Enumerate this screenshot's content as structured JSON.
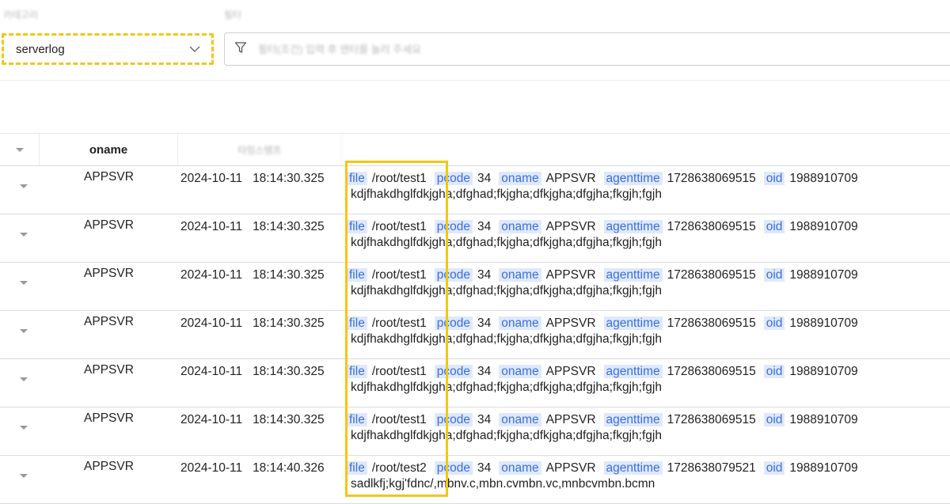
{
  "category": {
    "label": "카테고리",
    "value": "serverlog"
  },
  "filter": {
    "label": "필터",
    "placeholder": "필터(조건) 입력 후 엔터를 눌러 주세요"
  },
  "table": {
    "columns": [
      "oname",
      "타임스탬프"
    ],
    "rows": [
      {
        "oname": "APPSVR",
        "date": "2024-10-11",
        "time": "18:14:30.325",
        "fields": [
          {
            "k": "file",
            "v": "/root/test1"
          },
          {
            "k": "pcode",
            "v": "34"
          },
          {
            "k": "oname",
            "v": "APPSVR"
          },
          {
            "k": "agenttime",
            "v": "1728638069515"
          },
          {
            "k": "oid",
            "v": "1988910709"
          }
        ],
        "text": "kdjfhakdhglfdkjgha;dfghad;fkjgha;dfkjgha;dfgjha;fkgjh;fgjh"
      },
      {
        "oname": "APPSVR",
        "date": "2024-10-11",
        "time": "18:14:30.325",
        "fields": [
          {
            "k": "file",
            "v": "/root/test1"
          },
          {
            "k": "pcode",
            "v": "34"
          },
          {
            "k": "oname",
            "v": "APPSVR"
          },
          {
            "k": "agenttime",
            "v": "1728638069515"
          },
          {
            "k": "oid",
            "v": "1988910709"
          }
        ],
        "text": "kdjfhakdhglfdkjgha;dfghad;fkjgha;dfkjgha;dfgjha;fkgjh;fgjh"
      },
      {
        "oname": "APPSVR",
        "date": "2024-10-11",
        "time": "18:14:30.325",
        "fields": [
          {
            "k": "file",
            "v": "/root/test1"
          },
          {
            "k": "pcode",
            "v": "34"
          },
          {
            "k": "oname",
            "v": "APPSVR"
          },
          {
            "k": "agenttime",
            "v": "1728638069515"
          },
          {
            "k": "oid",
            "v": "1988910709"
          }
        ],
        "text": "kdjfhakdhglfdkjgha;dfghad;fkjgha;dfkjgha;dfgjha;fkgjh;fgjh"
      },
      {
        "oname": "APPSVR",
        "date": "2024-10-11",
        "time": "18:14:30.325",
        "fields": [
          {
            "k": "file",
            "v": "/root/test1"
          },
          {
            "k": "pcode",
            "v": "34"
          },
          {
            "k": "oname",
            "v": "APPSVR"
          },
          {
            "k": "agenttime",
            "v": "1728638069515"
          },
          {
            "k": "oid",
            "v": "1988910709"
          }
        ],
        "text": "kdjfhakdhglfdkjgha;dfghad;fkjgha;dfkjgha;dfgjha;fkgjh;fgjh"
      },
      {
        "oname": "APPSVR",
        "date": "2024-10-11",
        "time": "18:14:30.325",
        "fields": [
          {
            "k": "file",
            "v": "/root/test1"
          },
          {
            "k": "pcode",
            "v": "34"
          },
          {
            "k": "oname",
            "v": "APPSVR"
          },
          {
            "k": "agenttime",
            "v": "1728638069515"
          },
          {
            "k": "oid",
            "v": "1988910709"
          }
        ],
        "text": "kdjfhakdhglfdkjgha;dfghad;fkjgha;dfkjgha;dfgjha;fkgjh;fgjh"
      },
      {
        "oname": "APPSVR",
        "date": "2024-10-11",
        "time": "18:14:30.325",
        "fields": [
          {
            "k": "file",
            "v": "/root/test1"
          },
          {
            "k": "pcode",
            "v": "34"
          },
          {
            "k": "oname",
            "v": "APPSVR"
          },
          {
            "k": "agenttime",
            "v": "1728638069515"
          },
          {
            "k": "oid",
            "v": "1988910709"
          }
        ],
        "text": "kdjfhakdhglfdkjgha;dfghad;fkjgha;dfkjgha;dfgjha;fkgjh;fgjh"
      },
      {
        "oname": "APPSVR",
        "date": "2024-10-11",
        "time": "18:14:40.326",
        "fields": [
          {
            "k": "file",
            "v": "/root/test2"
          },
          {
            "k": "pcode",
            "v": "34"
          },
          {
            "k": "oname",
            "v": "APPSVR"
          },
          {
            "k": "agenttime",
            "v": "1728638079521"
          },
          {
            "k": "oid",
            "v": "1988910709"
          }
        ],
        "text": "sadlkfj;kgj'fdnc/,mbnv.c,mbn.cvmbn.vc,mnbcvmbn.bcmn"
      }
    ]
  },
  "colors": {
    "highlight": "#f5c518",
    "field_key_bg": "#dfe9fb",
    "field_key_text": "#3a6fe0"
  },
  "icons": {
    "category_dropdown": "chevron-down-icon",
    "filter": "filter-funnel-icon",
    "row_expand": "triangle-down-icon"
  }
}
